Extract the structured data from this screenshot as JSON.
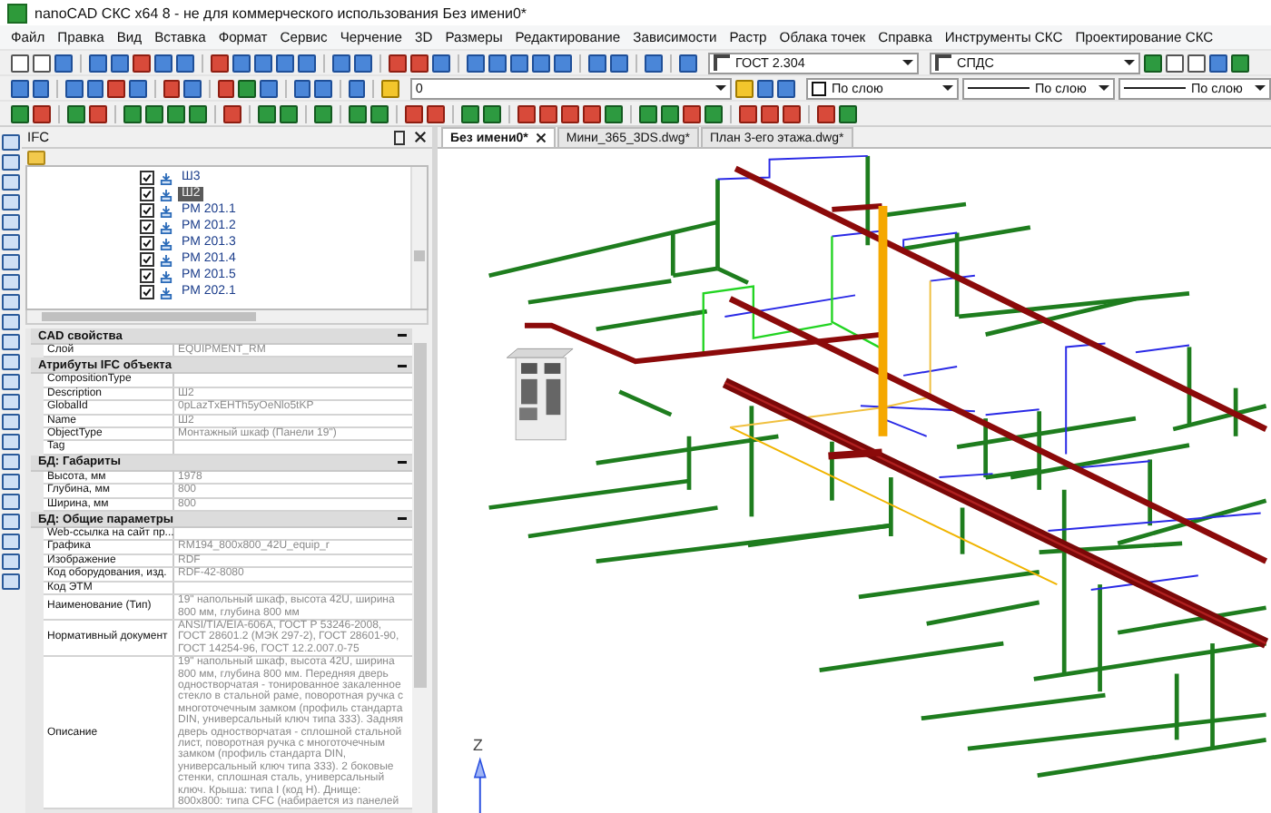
{
  "window": {
    "title": "nanoCAD СКС x64 8 - не для коммерческого использования Без имени0*"
  },
  "menu": [
    "Файл",
    "Правка",
    "Вид",
    "Вставка",
    "Формат",
    "Сервис",
    "Черчение",
    "3D",
    "Размеры",
    "Редактирование",
    "Зависимости",
    "Растр",
    "Облака точек",
    "Справка",
    "Инструменты СКС",
    "Проектирование СКС"
  ],
  "toolbar_row_1": {
    "dropdowns": [
      {
        "kind": "style",
        "value": "ГОСТ 2.304"
      },
      {
        "kind": "style",
        "value": "СПДС"
      }
    ]
  },
  "toolbar_row_2": {
    "dropdowns": [
      {
        "kind": "layer",
        "value": "0"
      },
      {
        "kind": "color",
        "value": "По слою"
      },
      {
        "kind": "line",
        "value": "По слою"
      },
      {
        "kind": "line",
        "value": "По слою"
      }
    ]
  },
  "panel": {
    "title": "IFC",
    "tree": [
      {
        "label": "Ш3",
        "checked": true,
        "selected": false
      },
      {
        "label": "Ш2",
        "checked": true,
        "selected": true
      },
      {
        "label": "РМ 201.1",
        "checked": true,
        "selected": false
      },
      {
        "label": "РМ 201.2",
        "checked": true,
        "selected": false
      },
      {
        "label": "РМ 201.3",
        "checked": true,
        "selected": false
      },
      {
        "label": "РМ 201.4",
        "checked": true,
        "selected": false
      },
      {
        "label": "РМ 201.5",
        "checked": true,
        "selected": false
      },
      {
        "label": "РМ 202.1",
        "checked": true,
        "selected": false
      }
    ],
    "groups": [
      {
        "title": "CAD свойства",
        "expanded": true,
        "rows": [
          {
            "label": "Слой",
            "value": "EQUIPMENT_RM"
          }
        ]
      },
      {
        "title": "Атрибуты IFC объекта",
        "expanded": true,
        "rows": [
          {
            "label": "CompositionType"
          },
          {
            "label": "Description",
            "value": "Ш2"
          },
          {
            "label": "GlobalId",
            "value": "0pLazTxEHTh5yOeNlo5tKP"
          },
          {
            "label": "Name",
            "value": "Ш2"
          },
          {
            "label": "ObjectType",
            "value": "Монтажный шкаф (Панели 19\")"
          },
          {
            "label": "Tag"
          }
        ]
      },
      {
        "title": "БД: Габариты",
        "expanded": true,
        "rows": [
          {
            "label": "Высота, мм",
            "value": "1978"
          },
          {
            "label": "Глубина, мм",
            "value": "800"
          },
          {
            "label": "Ширина, мм",
            "value": "800"
          }
        ]
      },
      {
        "title": "БД: Общие параметры",
        "expanded": true,
        "rows": [
          {
            "label": "Web-ссылка на сайт пр..."
          },
          {
            "label": "Графика",
            "value": "RM194_800x800_42U_equip_r"
          },
          {
            "label": "Изображение",
            "value": "RDF"
          },
          {
            "label": "Код оборудования, изд.",
            "value": "RDF-42-8080"
          },
          {
            "label": "Код ЭТМ"
          },
          {
            "label": "Наименование (Тип)",
            "value": "19\" напольный шкаф, высота 42U, ширина 800 мм, глубина 800 мм"
          },
          {
            "label": "Нормативный документ",
            "value": "ANSI/TIA/EIA-606A, ГОСТ Р 53246-2008, ГОСТ 28601.2 (МЭК 297-2), ГОСТ 28601-90, ГОСТ 14254-96, ГОСТ 12.2.007.0-75"
          },
          {
            "label": "Описание",
            "value": "19\" напольный шкаф, высота 42U, ширина 800 мм, глубина 800 мм. Передняя дверь одностворчатая - тонированное закаленное стекло в стальной раме, поворотная ручка с многоточечным замком (профиль стандарта DIN, универсальный ключ типа 333). Задняя дверь одностворчатая - сплошной стальной лист, поворотная ручка с многоточечным замком (профиль стандарта DIN, универсальный ключ типа 333). 2 боковые стенки, сплошная сталь, универсальный ключ. Крыша: типа I (код H). Днище: 800x800: типа CFC (набирается из панелей"
          }
        ]
      }
    ]
  },
  "tabs": [
    {
      "label": "Без имени0*",
      "selected": true
    },
    {
      "label": "Мини_365_3DS.dwg*",
      "selected": false
    },
    {
      "label": "План 3-его этажа.dwg*",
      "selected": false
    }
  ],
  "canvas": {
    "axis_label": "Z"
  }
}
